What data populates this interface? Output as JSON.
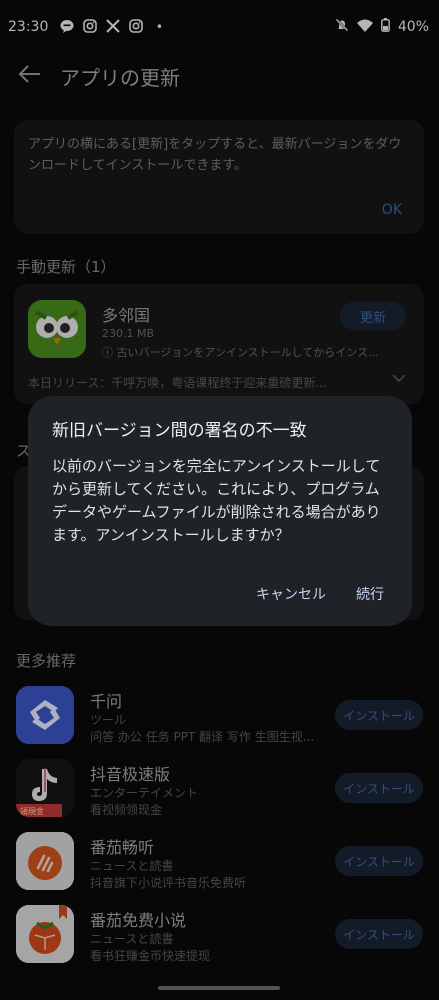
{
  "status_bar": {
    "time": "23:30",
    "notification_icons": [
      "line-icon",
      "instagram-icon",
      "x-icon",
      "instagram-icon"
    ],
    "dot": "•",
    "battery": "40%"
  },
  "app_bar": {
    "title": "アプリの更新"
  },
  "info": {
    "message": "アプリの横にある[更新]をタップすると、最新バージョンをダウンロードしてインストールできます。",
    "ok_label": "OK"
  },
  "manual_update": {
    "section_title": "手動更新（1）",
    "app": {
      "name": "多邻国",
      "size": "230.1 MB",
      "warning": "ⓘ 古いバージョンをアンインストールしてからインス...",
      "button": "更新",
      "release": "本日リリース：千呼万唤，粤语课程终于迎来重磅更新..."
    }
  },
  "hidden_section_initial": "ス",
  "recommendations": {
    "section_title": "更多推荐",
    "items": [
      {
        "name": "千问",
        "category": "ツール",
        "description": "问答 办公 任务 PPT 翻译 写作 生图生视...",
        "button": "インストール",
        "icon": "qianwen-icon"
      },
      {
        "name": "抖音极速版",
        "category": "エンターテイメント",
        "description": "看视频领现金",
        "button": "インストール",
        "icon": "douyin-icon"
      },
      {
        "name": "番茄畅听",
        "category": "ニュースと読書",
        "description": "抖音旗下小说评书音乐免费听",
        "button": "インストール",
        "icon": "tomato-listen-icon"
      },
      {
        "name": "番茄免费小说",
        "category": "ニュースと読書",
        "description": "看书狂赚金币快速提现",
        "button": "インストール",
        "icon": "tomato-novel-icon"
      }
    ]
  },
  "dialog": {
    "title": "新旧バージョン間の署名の不一致",
    "body": "以前のバージョンを完全にアンインストールしてから更新してください。これにより、プログラムデータやゲームファイルが削除される場合があります。アンインストールしますか？",
    "cancel_label": "キャンセル",
    "continue_label": "続行"
  },
  "colors": {
    "accent": "#3f6aa6",
    "dialog_bg": "#1f2227",
    "card_bg": "#171717"
  }
}
